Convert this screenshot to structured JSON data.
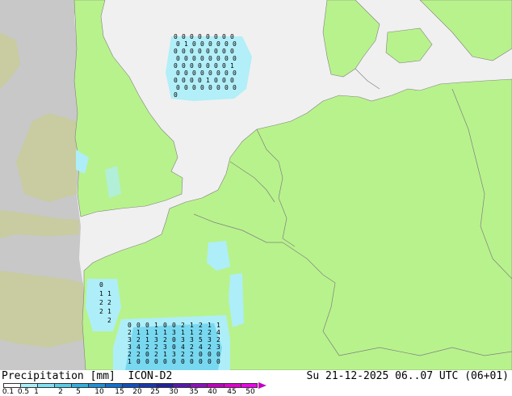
{
  "title_left": "Precipitation [mm]  ICON-D2",
  "title_right": "Su 21-12-2025 06..07 UTC (06+01)",
  "colors": {
    "sea": "#f0f0f0",
    "land_model": "#b8f28c",
    "land_outside": "#c8c8c8",
    "land_outside_green": "#c8cca0",
    "border": "#808080",
    "rain_light": "#aeeef8",
    "rain_medium": "#78d8f0"
  },
  "scale": {
    "labels": [
      "0.1",
      "0.5",
      "1",
      "2",
      "5",
      "10",
      "15",
      "20",
      "25",
      "30",
      "35",
      "40",
      "45",
      "50"
    ],
    "colors": [
      "#fefefe",
      "#a8eef8",
      "#80e0f4",
      "#58cce8",
      "#30b0e0",
      "#2090d8",
      "#1070d0",
      "#1050c0",
      "#1838b0",
      "#2020a0",
      "#5818b0",
      "#9010c0",
      "#c000c0",
      "#e000d0",
      "#f000f0"
    ]
  },
  "precip_labels": {
    "north_sea": [
      "0",
      "0",
      "0",
      "0",
      "0",
      "0",
      "0",
      "0",
      "0",
      "1",
      "0",
      "0",
      "0",
      "0",
      "0",
      "0",
      "0",
      "0",
      "0",
      "0",
      "0",
      "0",
      "0",
      "0",
      "0",
      "0",
      "0",
      "0",
      "0",
      "0",
      "0",
      "0",
      "0",
      "0",
      "0",
      "0",
      "0",
      "0",
      "0",
      "1",
      "0",
      "0",
      "0",
      "0",
      "0",
      "0",
      "0",
      "0",
      "0",
      "0",
      "0",
      "0",
      "1",
      "0",
      "0",
      "0",
      "0",
      "0",
      "0",
      "0",
      "0",
      "0",
      "0",
      "0",
      "0"
    ],
    "france": [
      "0",
      "1",
      "2",
      "2",
      "1",
      "2",
      "1",
      "2",
      "0",
      "0",
      "0",
      "1",
      "0",
      "0",
      "2",
      "1",
      "2",
      "1",
      "1",
      "2",
      "1",
      "1",
      "1",
      "1",
      "3",
      "1",
      "1",
      "2",
      "2",
      "4",
      "3",
      "2",
      "1",
      "3",
      "2",
      "0",
      "3",
      "3",
      "5",
      "3",
      "2",
      "3",
      "4",
      "2",
      "2",
      "3",
      "0",
      "4",
      "2",
      "4",
      "2",
      "3",
      "2",
      "2",
      "0",
      "2",
      "1",
      "3",
      "2",
      "2",
      "0",
      "0",
      "0",
      "1",
      "0",
      "0",
      "0",
      "0",
      "0",
      "0",
      "0",
      "0",
      "0",
      "0",
      "0",
      "0"
    ]
  }
}
